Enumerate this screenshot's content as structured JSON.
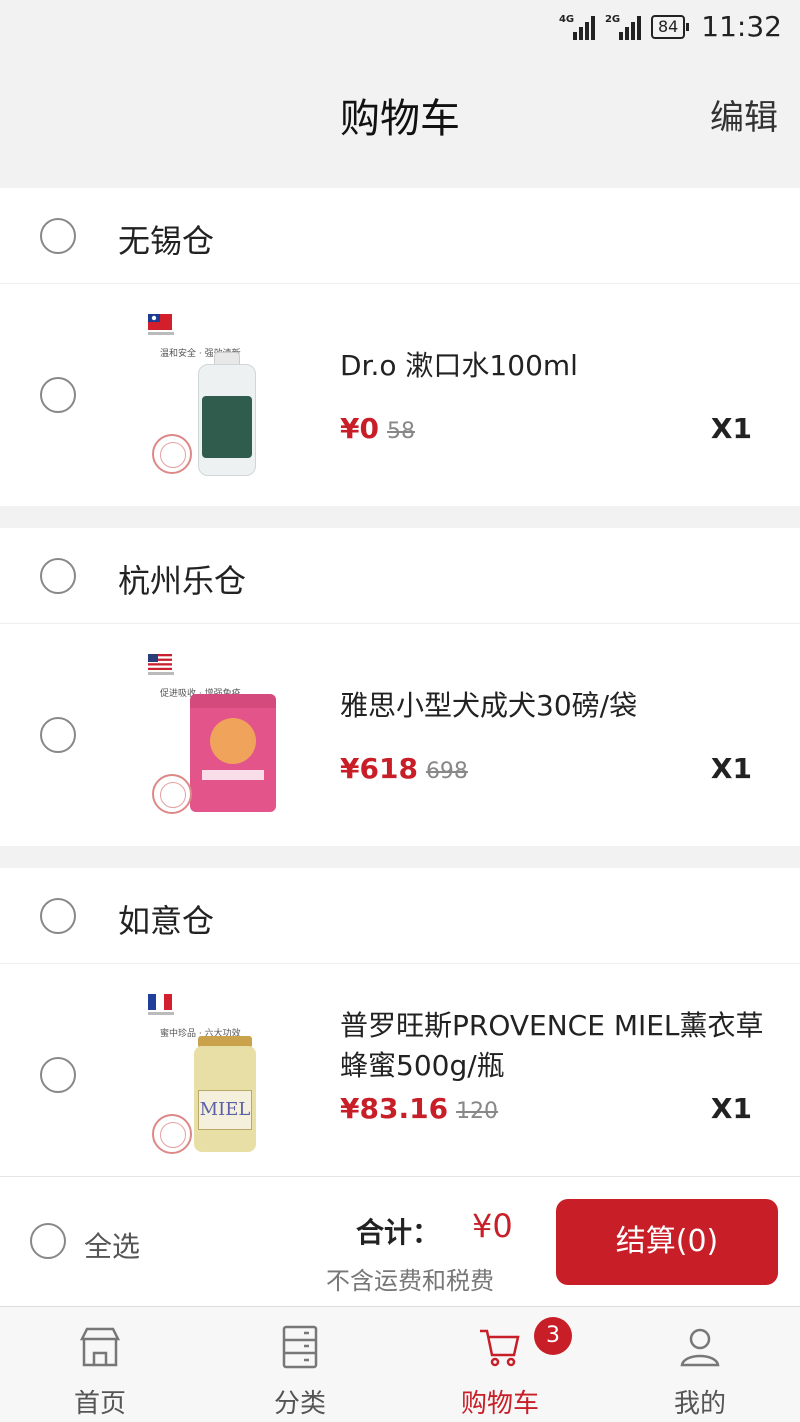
{
  "status_bar": {
    "signal_1_label": "4G",
    "signal_2_label": "2G",
    "battery": "84",
    "time": "11:32"
  },
  "header": {
    "title": "购物车",
    "edit_label": "编辑"
  },
  "warehouses": [
    {
      "name": "无锡仓",
      "item": {
        "name": "Dr.o 漱口水100ml",
        "price": "¥0",
        "original_price": "58",
        "quantity": "X1",
        "slogan": "温和安全 · 强效清新",
        "flag": "taiwan-flag-icon"
      }
    },
    {
      "name": "杭州乐仓",
      "item": {
        "name": "雅思小型犬成犬30磅/袋",
        "price": "¥618",
        "original_price": "698",
        "quantity": "X1",
        "slogan": "促进吸收 · 增强免疫",
        "flag": "usa-flag-icon"
      }
    },
    {
      "name": "如意仓",
      "item": {
        "name": "普罗旺斯PROVENCE MIEL薰衣草蜂蜜500g/瓶",
        "price": "¥83.16",
        "original_price": "120",
        "quantity": "X1",
        "slogan": "蜜中珍品 · 六大功效",
        "label": "MIEL",
        "flag": "france-flag-icon"
      }
    }
  ],
  "checkout": {
    "select_all_label": "全选",
    "total_label": "合计：",
    "total_value": "¥0",
    "note": "不含运费和税费",
    "pay_label": "结算(0)"
  },
  "tabbar": {
    "tabs": [
      {
        "label": "首页",
        "icon": "home-store-icon"
      },
      {
        "label": "分类",
        "icon": "category-cabinet-icon"
      },
      {
        "label": "购物车",
        "icon": "cart-icon",
        "badge": "3"
      },
      {
        "label": "我的",
        "icon": "user-icon"
      }
    ]
  },
  "colors": {
    "accent": "#c81e28",
    "background": "#f2f2f2"
  }
}
